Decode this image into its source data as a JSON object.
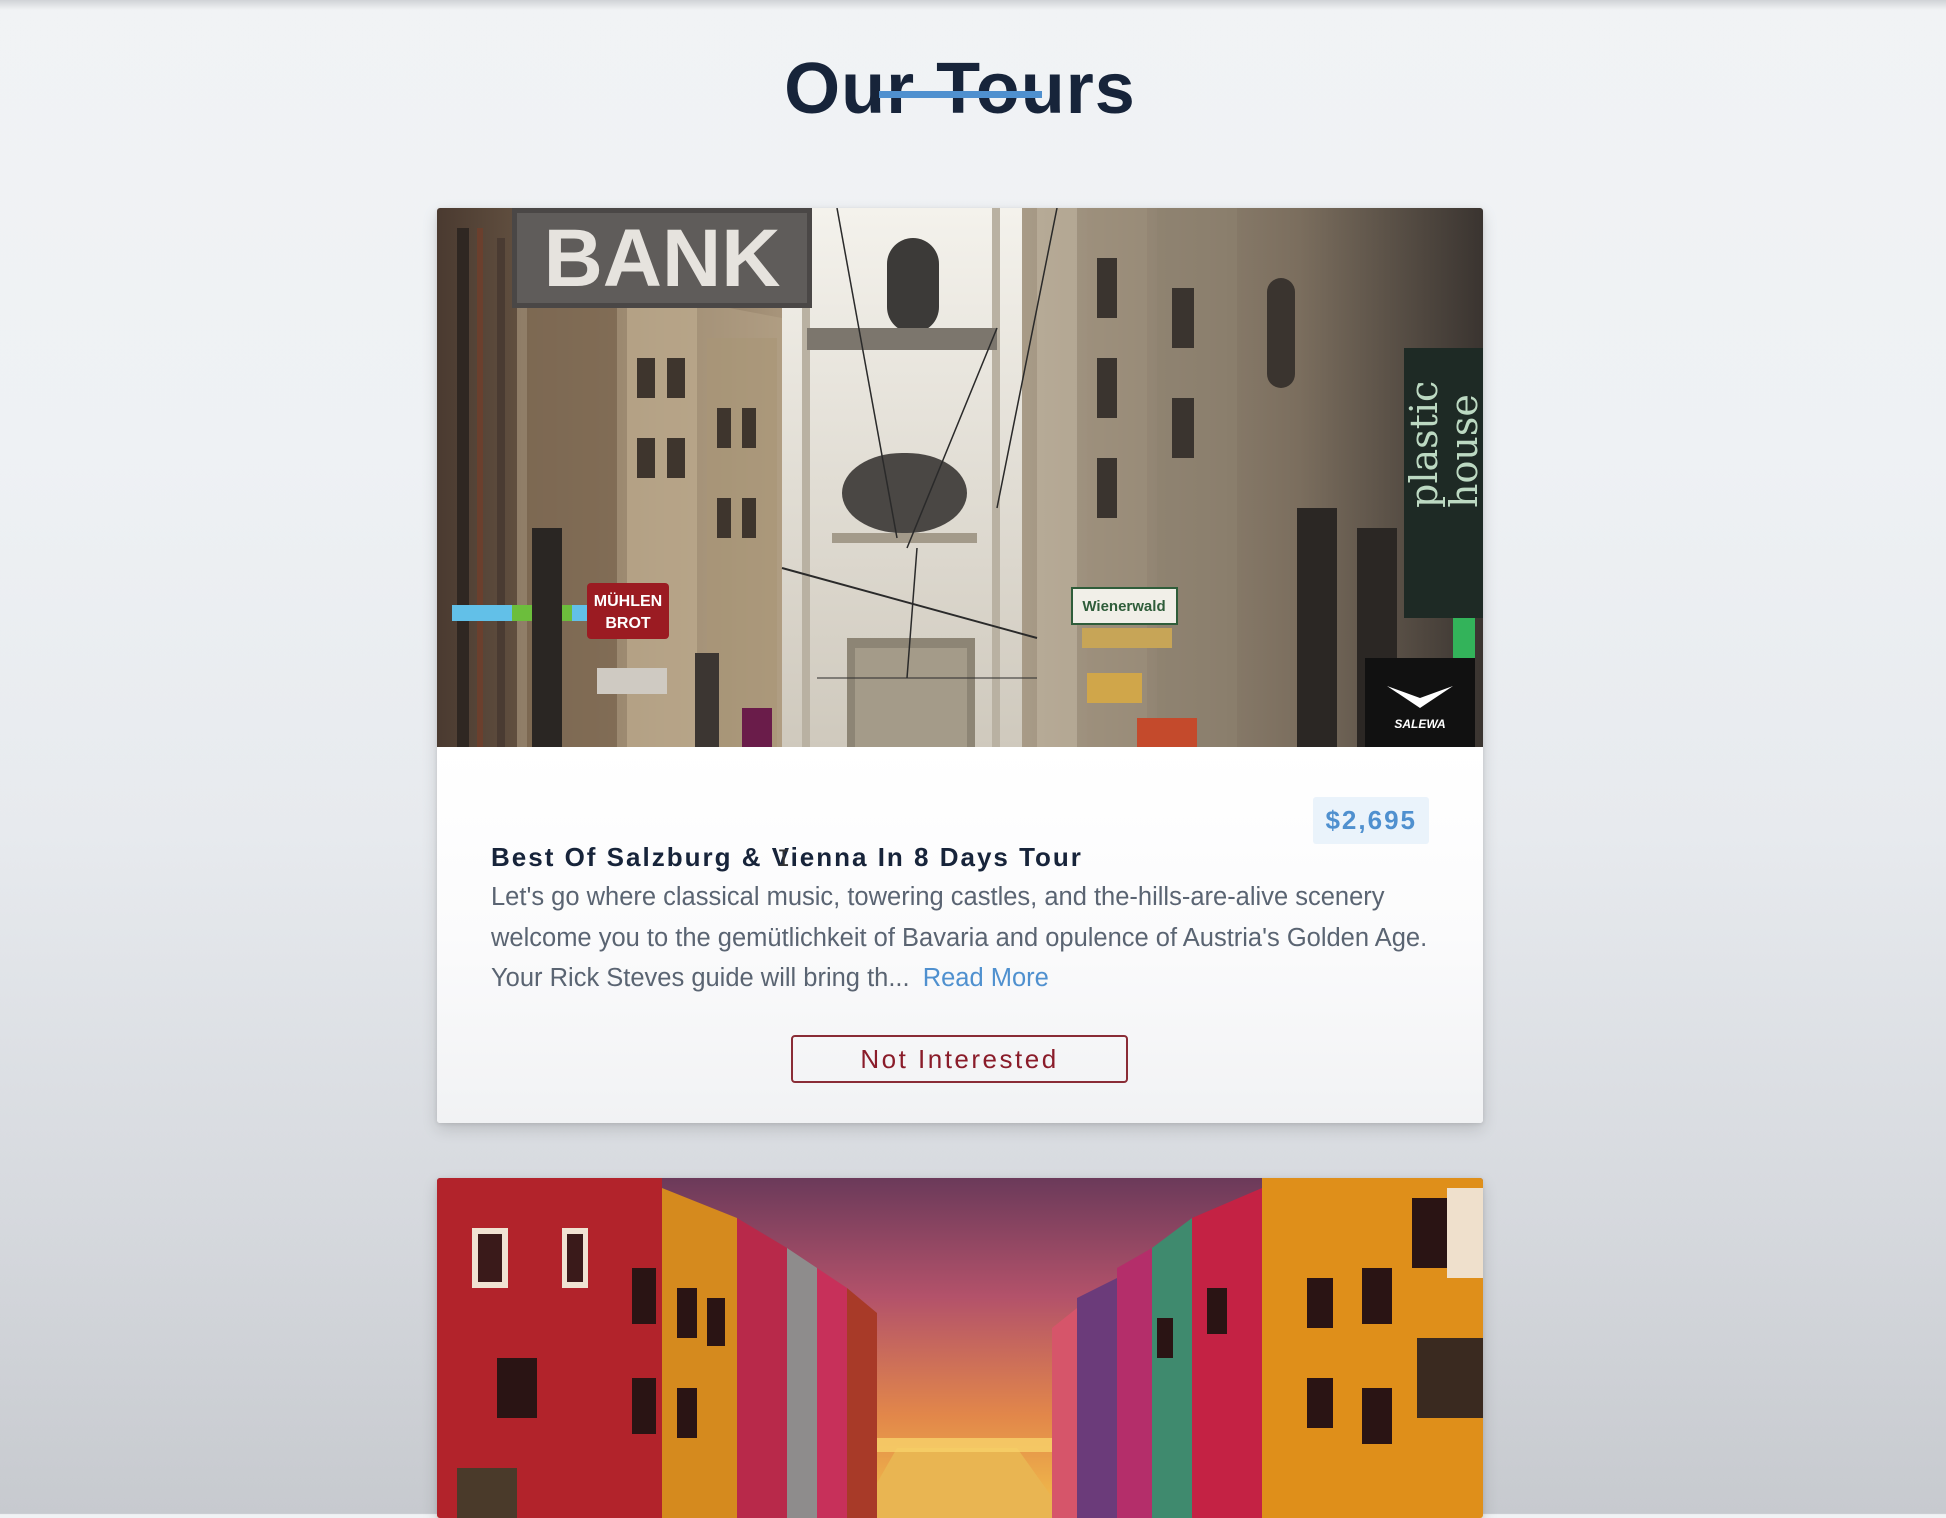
{
  "page": {
    "title": "Our Tours"
  },
  "tours": [
    {
      "name": "Best Of Salzburg & Vienna In 8 Days Tour",
      "price": "$2,695",
      "info": "Let's go where classical music, towering castles, and the-hills-are-alive scenery welcome you to the gemütlichkeit of Bavaria and opulence of Austria's Golden Age. Your Rick Steves guide will bring th...",
      "read_more_label": "Read More",
      "not_interested_label": "Not Interested",
      "image": {
        "sign_bank": "BANK",
        "sign_muhlen": "MÜHLEN",
        "sign_brot": "BROT",
        "sign_wienerwald": "Wienerwald",
        "sign_plastic": "plastic",
        "sign_house": "house",
        "sign_salewa": "SALEWA"
      }
    }
  ],
  "colors": {
    "accent": "#4f90cf",
    "heading": "#17243a",
    "body_text": "#5a6472",
    "danger": "#8a1c2a",
    "price_bg": "#eaf3fb"
  }
}
